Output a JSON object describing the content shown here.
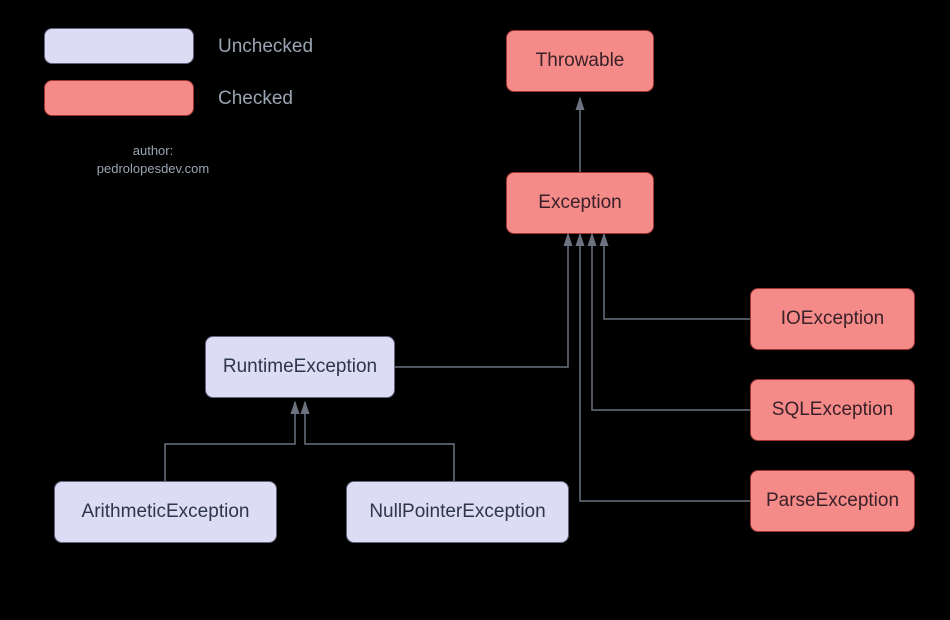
{
  "legend": {
    "unchecked_label": "Unchecked",
    "checked_label": "Checked"
  },
  "author": {
    "line1": "author:",
    "line2": "pedrolopesdev.com"
  },
  "nodes": {
    "throwable": {
      "label": "Throwable",
      "type": "checked"
    },
    "exception": {
      "label": "Exception",
      "type": "checked"
    },
    "runtime_exception": {
      "label": "RuntimeException",
      "type": "unchecked"
    },
    "arithmetic_exception": {
      "label": "ArithmeticException",
      "type": "unchecked"
    },
    "null_pointer_exception": {
      "label": "NullPointerException",
      "type": "unchecked"
    },
    "io_exception": {
      "label": "IOException",
      "type": "checked"
    },
    "sql_exception": {
      "label": "SQLException",
      "type": "checked"
    },
    "parse_exception": {
      "label": "ParseException",
      "type": "checked"
    }
  },
  "colors": {
    "unchecked_fill": "#dcdcf5",
    "checked_fill": "#f58b89",
    "connector": "#6b7280"
  },
  "chart_data": {
    "type": "tree",
    "description": "Java exception hierarchy showing checked vs unchecked exceptions",
    "edges": [
      {
        "from": "Exception",
        "to": "Throwable"
      },
      {
        "from": "RuntimeException",
        "to": "Exception"
      },
      {
        "from": "IOException",
        "to": "Exception"
      },
      {
        "from": "SQLException",
        "to": "Exception"
      },
      {
        "from": "ParseException",
        "to": "Exception"
      },
      {
        "from": "ArithmeticException",
        "to": "RuntimeException"
      },
      {
        "from": "NullPointerException",
        "to": "RuntimeException"
      }
    ],
    "categories": {
      "checked": [
        "Throwable",
        "Exception",
        "IOException",
        "SQLException",
        "ParseException"
      ],
      "unchecked": [
        "RuntimeException",
        "ArithmeticException",
        "NullPointerException"
      ]
    }
  }
}
